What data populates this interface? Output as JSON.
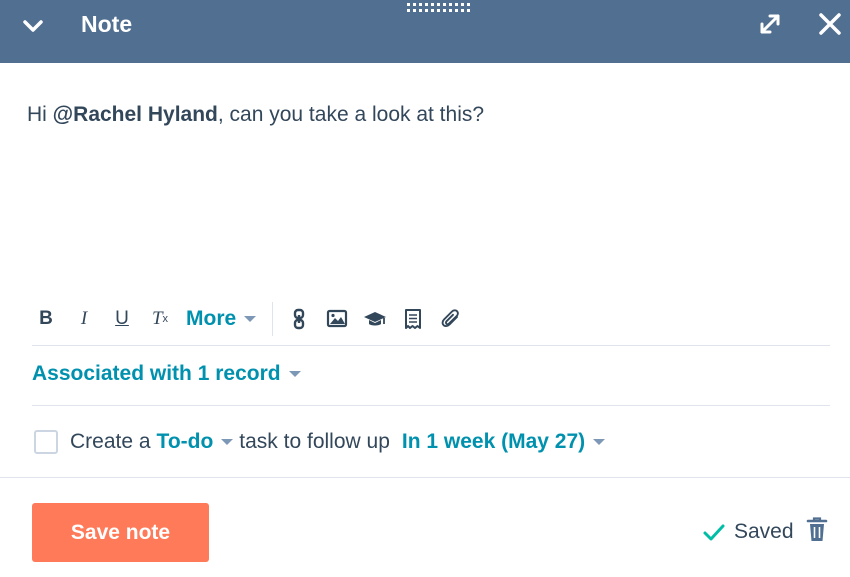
{
  "header": {
    "title": "Note",
    "collapse_icon": "chevron-down-icon",
    "expand_icon": "expand-icon",
    "close_icon": "close-icon",
    "drag_icon": "drag-handle-icon",
    "background": "#516f90"
  },
  "editor": {
    "prefix": "Hi ",
    "mention": "@Rachel Hyland",
    "suffix": ", can you take a look at this?"
  },
  "toolbar": {
    "bold_label": "B",
    "italic_label": "I",
    "underline_label": "U",
    "clear_label": "T",
    "clear_sub": "x",
    "more_label": "More",
    "icons": [
      "link-icon",
      "image-icon",
      "knowledge-base-icon",
      "document-icon",
      "attachment-icon"
    ]
  },
  "association": {
    "label": "Associated with 1 record"
  },
  "task": {
    "checked": false,
    "text_before": "Create a",
    "type_label": "To-do",
    "text_middle": "task to follow up",
    "due_label": "In 1 week (May 27)"
  },
  "footer": {
    "save_label": "Save note",
    "saved_label": "Saved",
    "accent": "#ff7a59",
    "link_color": "#0091ae",
    "success_color": "#00bda5"
  }
}
